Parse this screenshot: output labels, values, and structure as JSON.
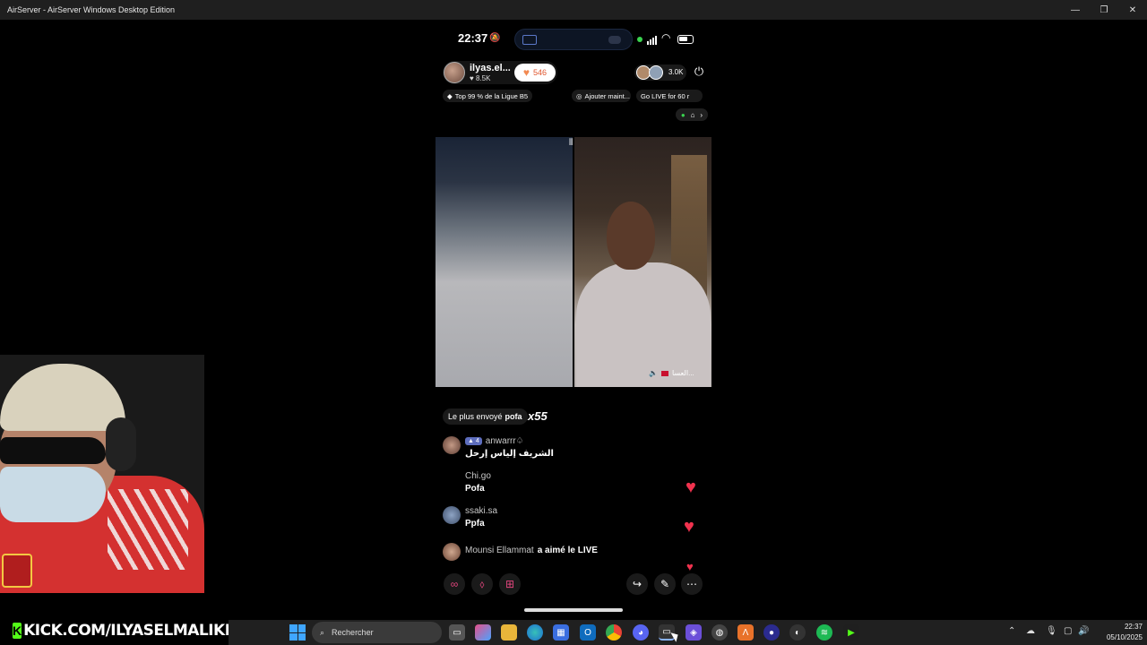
{
  "window": {
    "title": "AirServer - AirServer Windows Desktop Edition",
    "minimize_icon": "minimize-icon",
    "maximize_icon": "maximize-icon",
    "close_icon": "close-icon"
  },
  "phone_status": {
    "time": "22:37",
    "bell_icon": "bell-muted-icon"
  },
  "live": {
    "host_name": "ilyas.el...",
    "host_likes": "8.5K",
    "like_count": "546",
    "viewer_count": "3.0K",
    "chips": {
      "league": "Top 99 % de la Ligue B5",
      "add": "Ajouter maint...",
      "golive": "Go LIVE for 60 r"
    },
    "guest_name": "العسا..."
  },
  "gifts": {
    "most_sent_prefix": "Le plus envoyé",
    "most_sent_name": "pofa",
    "multiplier": "x55"
  },
  "comments": [
    {
      "badge": "4",
      "user": "anwarrr♤",
      "text": "الشريف إلياس إرحل"
    },
    {
      "user": "Chi.go",
      "text": "Pofa"
    },
    {
      "user": "ssaki.sa",
      "text": "Ppfa"
    },
    {
      "user": "Mounsi Ellammat",
      "text": "a aimé le LIVE"
    }
  ],
  "kick_banner": "KICK.COM/ILYASELMALIKI",
  "taskbar": {
    "search_placeholder": "Rechercher",
    "time": "22:37",
    "date": "05/10/2025"
  },
  "colors": {
    "accent_kick": "#53fc18",
    "heart": "#f0324e",
    "like_button_text": "#e0552d"
  }
}
